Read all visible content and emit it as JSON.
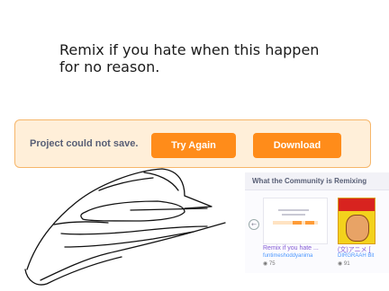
{
  "caption": {
    "line1": "Remix if you hate when this happen",
    "line2": "for no reason."
  },
  "alert": {
    "message": "Project could not save.",
    "retry_label": "Try Again",
    "download_label": "Download"
  },
  "community": {
    "heading": "What the Community is Remixing",
    "projects": [
      {
        "title": "Remix if you hate ...",
        "author": "funtimeshoddyanima",
        "views": "75"
      },
      {
        "title": "(文)アニメ [",
        "author": "DIRGRAAH Bit",
        "views": "91"
      }
    ]
  },
  "colors": {
    "accent": "#ff8c1a",
    "alert_bg": "#ffefd9",
    "alert_border": "#f6b66a"
  }
}
